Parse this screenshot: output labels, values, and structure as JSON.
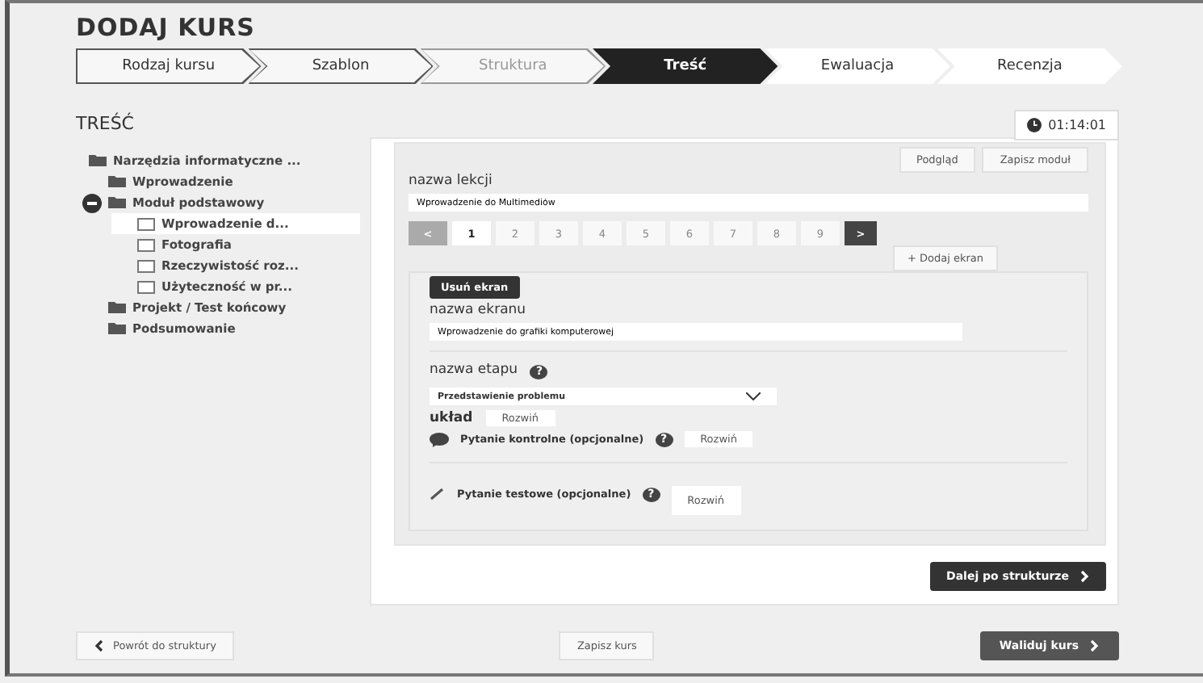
{
  "title": "DODAJ KURS",
  "steps": [
    {
      "label": "Rodzaj kursu",
      "selected": false,
      "visited": true,
      "disabled": false
    },
    {
      "label": "Szablon",
      "selected": false,
      "visited": true,
      "disabled": false
    },
    {
      "label": "Struktura",
      "selected": false,
      "visited": true,
      "disabled": true
    },
    {
      "label": "Treść",
      "selected": true,
      "visited": true,
      "disabled": false
    },
    {
      "label": "Ewaluacja",
      "selected": false,
      "visited": false,
      "disabled": false
    },
    {
      "label": "Recenzja",
      "selected": false,
      "visited": false,
      "disabled": false
    }
  ],
  "section_title": "TREŚĆ",
  "timer": "01:14:01",
  "tree": [
    {
      "label": "Narzędzia informatyczne ...",
      "kind": "folder",
      "expanded": false,
      "selected": false,
      "children": [
        {
          "label": "Wprowadzenie",
          "kind": "folder",
          "expanded": false,
          "selected": false
        },
        {
          "label": "Moduł podstawowy",
          "kind": "folder",
          "expanded": true,
          "selected": false,
          "children": [
            {
              "label": "Wprowadzenie d...",
              "kind": "page",
              "expanded": false,
              "selected": true
            },
            {
              "label": "Fotografia",
              "kind": "page",
              "expanded": false,
              "selected": false
            },
            {
              "label": "Rzeczywistość roz...",
              "kind": "page",
              "expanded": false,
              "selected": false
            },
            {
              "label": "Użyteczność w pr...",
              "kind": "page",
              "expanded": false,
              "selected": false
            }
          ]
        },
        {
          "label": "Projekt / Test końcowy",
          "kind": "folder",
          "expanded": false,
          "selected": false
        },
        {
          "label": "Podsumowanie",
          "kind": "folder",
          "expanded": false,
          "selected": false
        }
      ]
    }
  ],
  "top_buttons": [
    "Podgląd",
    "Zapisz moduł"
  ],
  "lesson": {
    "label": "nazwa lekcji",
    "value": "Wprowadzenie do Multimediów"
  },
  "pager": {
    "prev": "<",
    "next": ">",
    "pages": [
      {
        "label": "1",
        "selected": true
      },
      {
        "label": "2",
        "selected": false
      },
      {
        "label": "3",
        "selected": false
      },
      {
        "label": "4",
        "selected": false
      },
      {
        "label": "5",
        "selected": false
      },
      {
        "label": "6",
        "selected": false
      },
      {
        "label": "7",
        "selected": false
      },
      {
        "label": "8",
        "selected": false
      },
      {
        "label": "9",
        "selected": false
      }
    ]
  },
  "add_screen": "+ Dodaj ekran",
  "remove_screen": "Usuń ekran",
  "screen_name": {
    "label": "nazwa ekranu",
    "value": "Wprowadzenie do grafiki komputerowej"
  },
  "stage": {
    "label": "nazwa etapu",
    "help": "?",
    "value": "Przedstawienie problemu"
  },
  "layout": {
    "label": "układ",
    "button": "Rozwiń"
  },
  "questions": [
    {
      "label": "Pytanie kontrolne (opcjonalne)",
      "kind": "chat",
      "help": "?",
      "button": "Rozwiń"
    },
    {
      "label": "Pytanie testowe (opcjonalne)",
      "kind": "pencil",
      "help": "?",
      "button": "Rozwiń"
    }
  ],
  "next_button": "Dalej po strukturze",
  "footer": {
    "back": "Powrót do struktury",
    "save": "Zapisz kurs",
    "validate": "Waliduj kurs"
  }
}
